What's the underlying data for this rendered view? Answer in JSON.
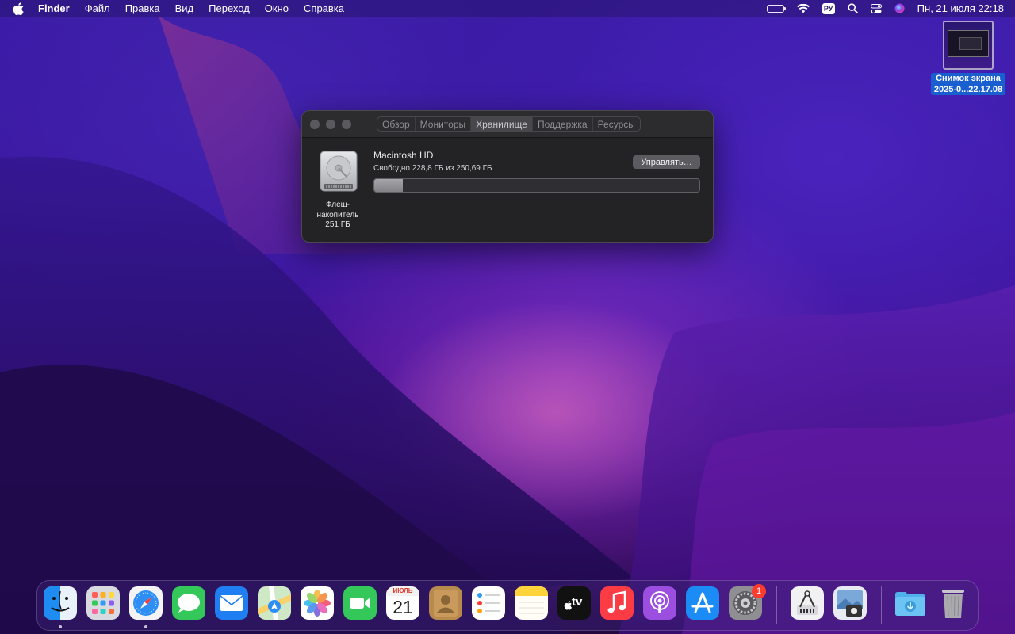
{
  "menubar": {
    "app_name": "Finder",
    "menus": [
      "Файл",
      "Правка",
      "Вид",
      "Переход",
      "Окно",
      "Справка"
    ],
    "input_source": "РУ",
    "clock": "Пн, 21 июля  22:18",
    "icons": [
      "apple-icon",
      "battery-icon",
      "wifi-icon",
      "input-source-icon",
      "spotlight-icon",
      "control-center-icon",
      "siri-icon"
    ]
  },
  "desktop": {
    "file_label_line1": "Снимок экрана",
    "file_label_line2": "2025-0...22.17.08"
  },
  "about_window": {
    "tabs": [
      {
        "label": "Обзор",
        "active": false
      },
      {
        "label": "Мониторы",
        "active": false
      },
      {
        "label": "Хранилище",
        "active": true
      },
      {
        "label": "Поддержка",
        "active": false
      },
      {
        "label": "Ресурсы",
        "active": false
      }
    ],
    "drive": {
      "caption_line1": "Флеш-",
      "caption_line2": "накопитель",
      "caption_line3": "251 ГБ",
      "icon": "hard-drive-icon"
    },
    "volume": {
      "name": "Macintosh HD",
      "free_text": "Свободно 228,8 ГБ из 250,69 ГБ",
      "used_fraction": 0.087
    },
    "manage_button": "Управлять…"
  },
  "dock": {
    "apps": [
      "finder",
      "launchpad",
      "safari",
      "messages",
      "mail",
      "maps",
      "photos",
      "facetime",
      "calendar",
      "contacts",
      "reminders",
      "notes",
      "tv",
      "music",
      "podcasts",
      "app-store",
      "system-preferences",
      "screenshot-utility",
      "preview",
      "downloads",
      "trash"
    ],
    "calendar_month": "ИЮЛЬ",
    "calendar_day": "21",
    "tv_label": "tv",
    "system_preferences_badge": "1",
    "colors": {
      "finder": "#1e8cf0",
      "messages": "#34c759",
      "facetime": "#34c759",
      "mail": "#1f7ff2",
      "music": "#fc3c44",
      "podcasts": "#9b4ee0",
      "app_store": "#1b8cf5"
    }
  }
}
